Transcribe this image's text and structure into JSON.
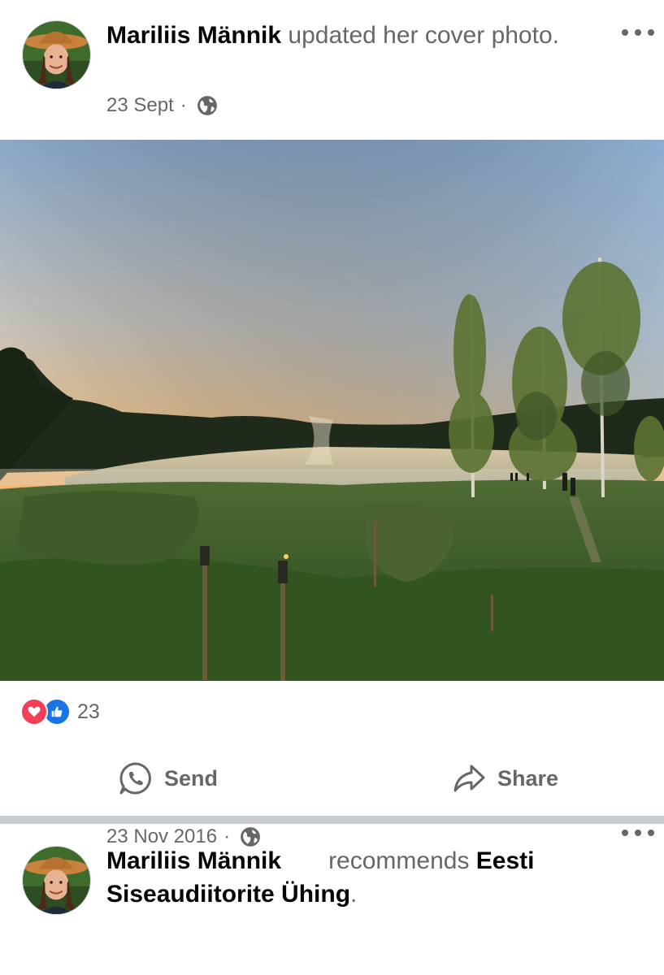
{
  "posts": [
    {
      "author": "Mariliis Männik",
      "action_text": " updated her cover photo.",
      "date": "23 Sept",
      "audience_icon": "globe-icon",
      "reactions": {
        "types": [
          "love",
          "like"
        ],
        "count": "23"
      },
      "buttons": {
        "send_label": "Send",
        "share_label": "Share"
      }
    },
    {
      "author": "Mariliis Männik",
      "action_text": "recommends ",
      "page_name": "Eesti Siseaudiitorite Ühing",
      "trailing": ".",
      "date": "23 Nov 2016",
      "audience_icon": "globe-icon"
    }
  ],
  "colors": {
    "text_primary": "#050505",
    "text_secondary": "#65676b",
    "love": "#f33e58",
    "like": "#1b74e4",
    "divider": "#c9ccd1"
  }
}
